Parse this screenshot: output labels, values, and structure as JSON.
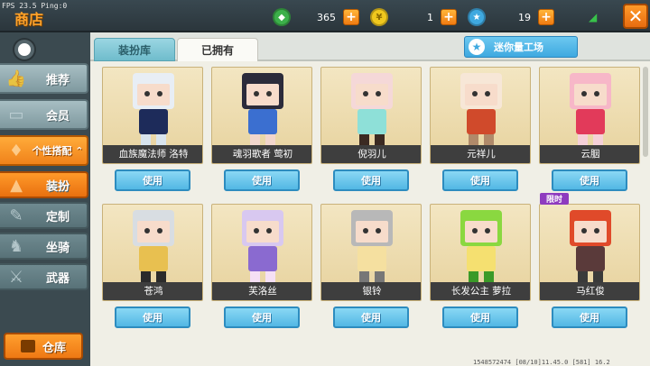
{
  "debug": {
    "fps_text": "FPS 23.5  Ping:0"
  },
  "header": {
    "title": "商店",
    "currencies": [
      {
        "icon": "green-gem-icon",
        "value": "365",
        "color": "#3cb04a"
      },
      {
        "icon": "gold-coin-icon",
        "value": "1",
        "color": "#f0c81e"
      },
      {
        "icon": "blue-star-coin-icon",
        "value": "19",
        "color": "#3fa9e0"
      }
    ]
  },
  "sidebar": {
    "items": [
      {
        "label": "推荐",
        "icon": "thumbs-up-icon"
      },
      {
        "label": "会员",
        "icon": "vip-card-icon"
      },
      {
        "label": "个性搭配",
        "icon": "dress-up-icon"
      },
      {
        "label": "装扮",
        "icon": "costume-icon"
      },
      {
        "label": "定制",
        "icon": "custom-icon"
      },
      {
        "label": "坐骑",
        "icon": "mount-icon"
      },
      {
        "label": "武器",
        "icon": "gun-icon"
      }
    ],
    "warehouse_label": "仓库"
  },
  "tabs": [
    {
      "label": "装扮库"
    },
    {
      "label": "已拥有"
    }
  ],
  "workshop_label": "迷你量工场",
  "skins": [
    {
      "name": "血族魔法师 洛特",
      "button": "使用",
      "badge": ""
    },
    {
      "name": "魂羽歌者 莺初",
      "button": "使用",
      "badge": ""
    },
    {
      "name": "倪羽儿",
      "button": "使用",
      "badge": ""
    },
    {
      "name": "元祥儿",
      "button": "使用",
      "badge": ""
    },
    {
      "name": "云胭",
      "button": "使用",
      "badge": ""
    },
    {
      "name": "苍鸿",
      "button": "使用",
      "badge": ""
    },
    {
      "name": "芙洛丝",
      "button": "使用",
      "badge": ""
    },
    {
      "name": "银铃",
      "button": "使用",
      "badge": ""
    },
    {
      "name": "长发公主 萝拉",
      "button": "使用",
      "badge": ""
    },
    {
      "name": "马红俊",
      "button": "使用",
      "badge": "限时"
    }
  ],
  "footer_text": "1548572474  [08/10]11.45.0   [581] 16.2"
}
